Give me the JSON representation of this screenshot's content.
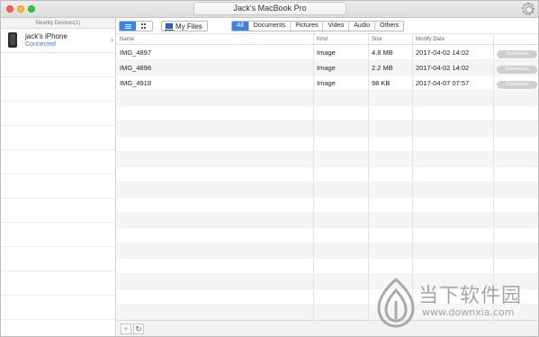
{
  "window": {
    "title": "Jack's MacBook Pro"
  },
  "sidebar": {
    "header": "Nearby Devices(1)",
    "devices": [
      {
        "name": "jack's iPhone",
        "status": "Connected",
        "chevron": "›"
      }
    ]
  },
  "toolbar": {
    "my_files_label": "My Files",
    "filters": [
      "All",
      "Documents",
      "Pictures",
      "Video",
      "Audio",
      "Others"
    ],
    "active_filter": "All"
  },
  "table": {
    "columns": [
      "Name",
      "Kind",
      "Size",
      "Modify Date",
      ""
    ],
    "rows": [
      {
        "name": "IMG_4897",
        "kind": "Image",
        "size": "4.8 MB",
        "date": "2017-04-02 14:02",
        "action": "Download"
      },
      {
        "name": "IMG_4898",
        "kind": "Image",
        "size": "2.2 MB",
        "date": "2017-04-02 14:02",
        "action": "Download"
      },
      {
        "name": "IMG_4918",
        "kind": "Image",
        "size": "98 KB",
        "date": "2017-04-07 07:57",
        "action": "Download"
      }
    ]
  },
  "bottombar": {
    "add_glyph": "+",
    "refresh_glyph": "↻"
  },
  "watermark": {
    "title": "当下软件园",
    "url": "www.downxia.com"
  },
  "colors": {
    "accent": "#3b82e6",
    "connected": "#3b7ad9",
    "download_button": "#cfcfcf"
  },
  "icons": {
    "phone": "iphone-icon",
    "list_view": "list-view-icon",
    "grid_view": "grid-view-icon",
    "my_files": "laptop-icon",
    "settings": "gear-icon"
  }
}
